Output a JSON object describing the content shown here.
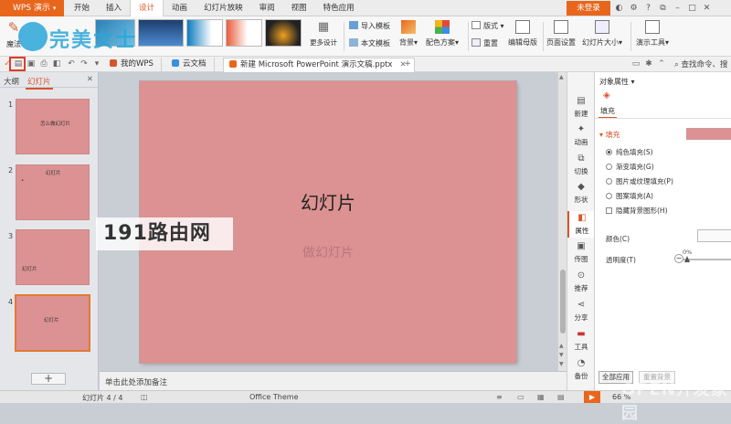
{
  "titlebar": {
    "app_name": "WPS 演示",
    "tabs": [
      "开始",
      "插入",
      "设计",
      "动画",
      "幻灯片放映",
      "审阅",
      "视图",
      "特色应用"
    ],
    "active_tab": "设计",
    "login": "未登录"
  },
  "ribbon": {
    "magic": "魔法",
    "more_design": "更多设计",
    "import_template": "导入模板",
    "text_template": "本文模板",
    "background": "背景",
    "color_scheme": "配色方案",
    "layout": "版式",
    "reset": "重置",
    "edit_master": "编辑母版",
    "page_setup": "页面设置",
    "slide_size": "幻灯片大小",
    "presentation_tools": "演示工具"
  },
  "doc_tabs": {
    "my_wps": "我的WPS",
    "cloud_docs": "云文档",
    "current_doc": "新建 Microsoft PowerPoint 演示文稿.pptx",
    "search_cmd": "查找命令、搜"
  },
  "outline": {
    "tab_outline": "大纲",
    "tab_slides": "幻灯片",
    "slides": [
      {
        "num": "1",
        "text": "怎么做幻灯片"
      },
      {
        "num": "2",
        "text": "幻灯片"
      },
      {
        "num": "3",
        "text": "幻灯片"
      },
      {
        "num": "4",
        "text": "幻灯片"
      }
    ]
  },
  "slide": {
    "title": "幻灯片",
    "subtitle": "做幻灯片"
  },
  "notes_placeholder": "单击此处添加备注",
  "sidebar": [
    "新建",
    "动画",
    "切换",
    "形状",
    "属性",
    "传图",
    "推荐",
    "分享",
    "工具",
    "备份"
  ],
  "props": {
    "header": "对象属性",
    "tab": "填充",
    "section": "填充",
    "options": [
      "纯色填充(S)",
      "渐变填充(G)",
      "图片或纹理填充(P)",
      "图案填充(A)"
    ],
    "hide_bg": "隐藏背景图形(H)",
    "color_label": "颜色(C)",
    "transparency_label": "透明度(T)",
    "transparency_value": "0%",
    "apply_all": "全部应用",
    "reset_bg": "重置背景"
  },
  "status": {
    "slide_info": "幻灯片 4 / 4",
    "theme": "Office Theme",
    "zoom": "66 %"
  },
  "watermarks": {
    "left": "191路由网",
    "logo_text": "完美女士",
    "bottom_right": "OPEN开发家园"
  },
  "colors": {
    "accent": "#e8661c",
    "slide_bg": "#dc9292"
  }
}
